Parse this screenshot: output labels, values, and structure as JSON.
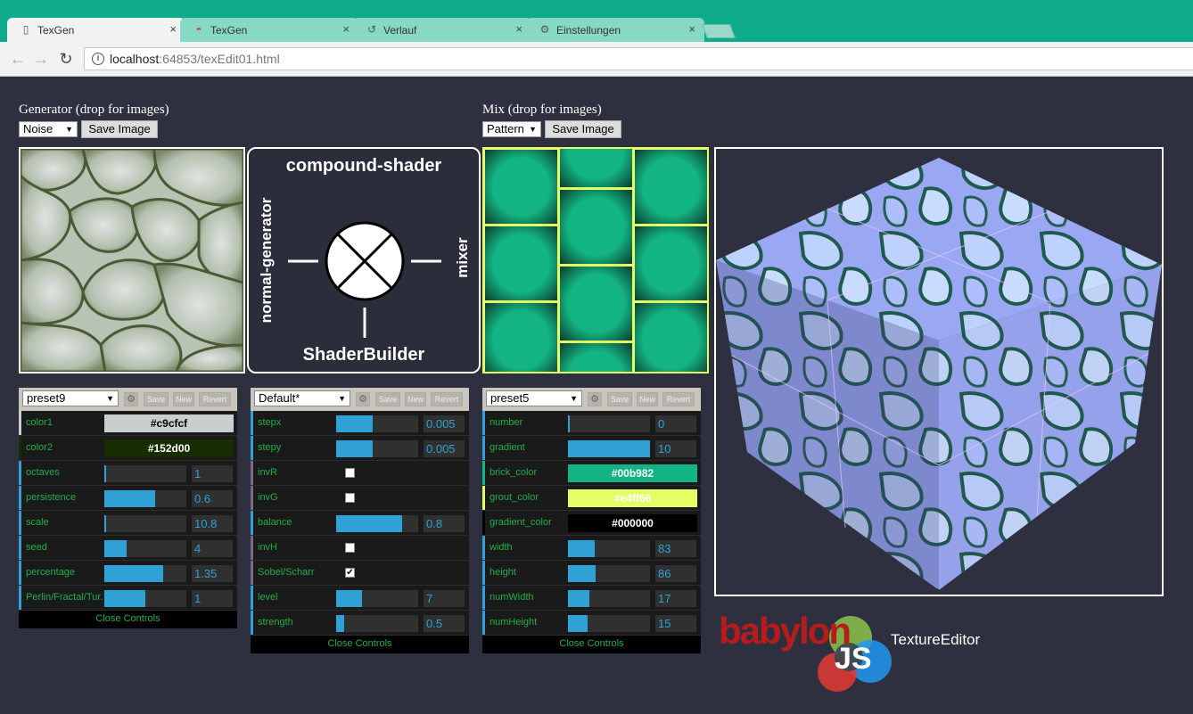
{
  "browser": {
    "tabs": [
      {
        "label": "TexGen",
        "icon": "page-icon",
        "active": true
      },
      {
        "label": "TexGen",
        "icon": "babylon-favicon-icon",
        "active": false
      },
      {
        "label": "Verlauf",
        "icon": "history-icon",
        "active": false
      },
      {
        "label": "Einstellungen",
        "icon": "gear-icon",
        "active": false
      }
    ],
    "close_glyph": "×",
    "url_host": "localhost",
    "url_rest": ":64853/texEdit01.html"
  },
  "generator": {
    "heading": "Generator (drop for images)",
    "type_value": "Noise",
    "save_label": "Save Image"
  },
  "mix": {
    "heading": "Mix (drop for images)",
    "type_value": "Pattern",
    "save_label": "Save Image"
  },
  "diagram": {
    "title": "compound-shader",
    "left": "normal-generator",
    "right": "mixer",
    "bottom": "ShaderBuilder"
  },
  "panel_head": {
    "save": "Save",
    "new": "New",
    "revert": "Revert",
    "close": "Close Controls"
  },
  "panel1": {
    "preset": "preset9",
    "rows": [
      {
        "type": "color",
        "label": "color1",
        "value": "#c9cfcf",
        "bg": "#c9cfcf",
        "fg": "#000000"
      },
      {
        "type": "color",
        "label": "color2",
        "value": "#152d00",
        "bg": "#152d00",
        "fg": "#ffffff"
      },
      {
        "type": "number",
        "label": "octaves",
        "value": "1",
        "fraction": 0
      },
      {
        "type": "number",
        "label": "persistence",
        "value": "0.6",
        "fraction": 0.62
      },
      {
        "type": "number",
        "label": "scale",
        "value": "10.8",
        "fraction": 0.02
      },
      {
        "type": "number",
        "label": "seed",
        "value": "4",
        "fraction": 0.27
      },
      {
        "type": "number",
        "label": "percentage",
        "value": "1.35",
        "fraction": 0.72
      },
      {
        "type": "number",
        "label": "Perlin/Fractal/Tur..",
        "value": "1",
        "fraction": 0.5
      }
    ]
  },
  "panel2": {
    "preset": "Default*",
    "rows": [
      {
        "type": "number",
        "label": "stepx",
        "value": "0.005",
        "fraction": 0.45
      },
      {
        "type": "number",
        "label": "stepy",
        "value": "0.005",
        "fraction": 0.45
      },
      {
        "type": "bool",
        "label": "invR",
        "checked": false
      },
      {
        "type": "bool",
        "label": "invG",
        "checked": false
      },
      {
        "type": "number",
        "label": "balance",
        "value": "0.8",
        "fraction": 0.8
      },
      {
        "type": "bool",
        "label": "invH",
        "checked": false
      },
      {
        "type": "bool",
        "label": "Sobel/Scharr",
        "checked": true
      },
      {
        "type": "number",
        "label": "level",
        "value": "7",
        "fraction": 0.32
      },
      {
        "type": "number",
        "label": "strength",
        "value": "0.5",
        "fraction": 0.1
      }
    ]
  },
  "panel3": {
    "preset": "preset5",
    "rows": [
      {
        "type": "number",
        "label": "number",
        "value": "0",
        "fraction": 0
      },
      {
        "type": "number",
        "label": "gradient",
        "value": "10",
        "fraction": 1
      },
      {
        "type": "color",
        "label": "brick_color",
        "value": "#00b982",
        "bg": "#13b483",
        "fg": "#ffffff"
      },
      {
        "type": "color",
        "label": "grout_color",
        "value": "#e4ff66",
        "bg": "#e4ff66",
        "fg": "#ffffff"
      },
      {
        "type": "color",
        "label": "gradient_color",
        "value": "#000000",
        "bg": "#000000",
        "fg": "#ffffff"
      },
      {
        "type": "number",
        "label": "width",
        "value": "83",
        "fraction": 0.33
      },
      {
        "type": "number",
        "label": "height",
        "value": "86",
        "fraction": 0.34
      },
      {
        "type": "number",
        "label": "numWidth",
        "value": "17",
        "fraction": 0.26
      },
      {
        "type": "number",
        "label": "numHeight",
        "value": "15",
        "fraction": 0.24
      }
    ]
  },
  "branding": {
    "logo_word": "babylon",
    "logo_js": "JS",
    "app_name": "TextureEditor"
  },
  "colors": {
    "accent_green": "#1eaf48",
    "slider_blue": "#2fa1d6",
    "bg": "#2f303f",
    "tab_bar": "#0fac8c"
  }
}
